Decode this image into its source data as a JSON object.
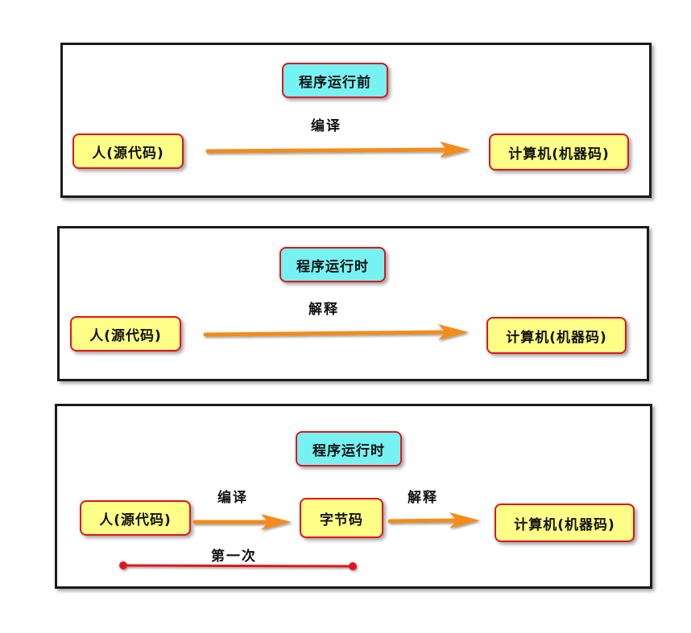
{
  "panel1": {
    "title": "程序运行前",
    "source": "人(源代码)",
    "edge_label": "编译",
    "target": "计算机(机器码)"
  },
  "panel2": {
    "title": "程序运行时",
    "source": "人(源代码)",
    "edge_label": "解释",
    "target": "计算机(机器码)"
  },
  "panel3": {
    "title": "程序运行时",
    "source": "人(源代码)",
    "edge1_label": "编译",
    "middle": "字节码",
    "edge2_label": "解释",
    "target": "计算机(机器码)",
    "bracket_label": "第一次"
  },
  "colors": {
    "node_fill": "#ffff88",
    "title_fill": "#77f2f2",
    "node_border": "#e0141e",
    "arrow": "#f28c1e",
    "bracket": "#e0141e"
  }
}
